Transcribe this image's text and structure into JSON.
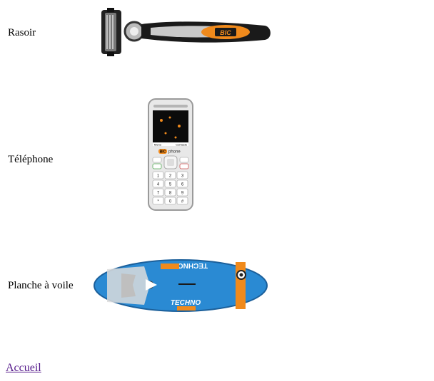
{
  "products": [
    {
      "label": "Rasoir",
      "image": "razor-image",
      "brand": "BIC"
    },
    {
      "label": "Téléphone",
      "image": "phone-image",
      "brand": "BIC",
      "screen_left": "Menu",
      "screen_right": "Contacts",
      "logo_suffix": "phone",
      "keys": [
        "1",
        "2",
        "3",
        "4",
        "5",
        "6",
        "7",
        "8",
        "9",
        "*",
        "0",
        "#"
      ]
    },
    {
      "label": "Planche à voile",
      "image": "windsurf-board-image",
      "brand": "TECHNO"
    }
  ],
  "footer": {
    "home_link": "Accueil"
  },
  "colors": {
    "link_visited": "#551a8b",
    "board_blue": "#2a8ad3",
    "accent_orange": "#f08a1c"
  }
}
